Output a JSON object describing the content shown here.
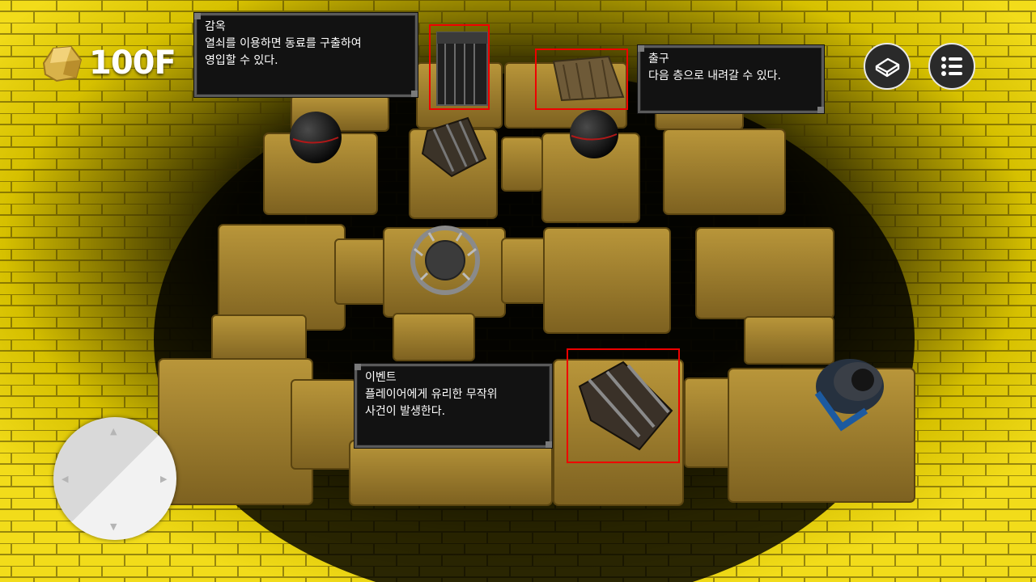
{
  "hud": {
    "floor_label": "100F",
    "gold_icon": "gold-nugget-icon",
    "book_button_icon": "book-icon",
    "menu_button_icon": "menu-list-icon"
  },
  "tooltips": {
    "prison": {
      "title": "감옥",
      "line1": "열쇠를 이용하면 동료를 구출하여",
      "line2": "영입할 수 있다."
    },
    "exit": {
      "title": "출구",
      "line1": "다음 층으로 내려갈 수 있다."
    },
    "event": {
      "title": "이벤트",
      "line1": "플레이어에게 유리한 무작위",
      "line2": "사건이 발생한다."
    }
  },
  "colors": {
    "highlight": "#e00000",
    "wall": "#d9c200",
    "floor_tile": "#a8862c",
    "tooltip_bg": "#121212"
  },
  "scene_objects": [
    "prison-cage",
    "exit-trapdoor",
    "barrel",
    "bear-trap",
    "black-bomb",
    "black-bomb",
    "treasure-chest",
    "knight-player"
  ],
  "joystick": {
    "arrows": [
      "▲",
      "▼",
      "◀",
      "▶"
    ]
  }
}
